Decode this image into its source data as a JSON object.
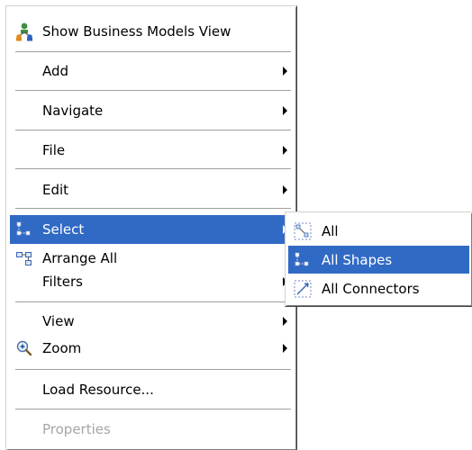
{
  "main_menu": {
    "show_business_models": {
      "label": "Show Business Models View",
      "icon": "business-models-icon"
    },
    "add": {
      "label": "Add"
    },
    "navigate": {
      "label": "Navigate"
    },
    "file": {
      "label": "File"
    },
    "edit": {
      "label": "Edit"
    },
    "select": {
      "label": "Select",
      "icon": "select-shapes-icon"
    },
    "arrange_all": {
      "label": "Arrange All",
      "icon": "arrange-all-icon"
    },
    "filters": {
      "label": "Filters"
    },
    "view": {
      "label": "View"
    },
    "zoom": {
      "label": "Zoom",
      "icon": "zoom-in-icon"
    },
    "load_resource": {
      "label": "Load Resource..."
    },
    "properties": {
      "label": "Properties",
      "disabled": true
    }
  },
  "select_submenu": {
    "all": {
      "label": "All",
      "icon": "select-all-icon"
    },
    "all_shapes": {
      "label": "All Shapes",
      "icon": "select-shapes-icon"
    },
    "all_connectors": {
      "label": "All Connectors",
      "icon": "select-connectors-icon"
    }
  },
  "colors": {
    "highlight": "#316ac5",
    "disabled_text": "#a6a6a6"
  }
}
